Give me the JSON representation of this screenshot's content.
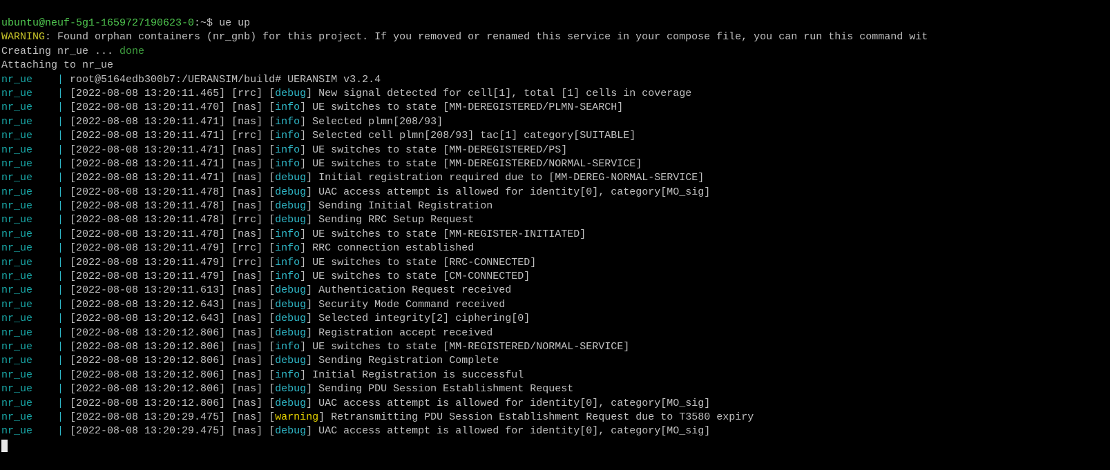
{
  "prompt": {
    "user_host": "ubuntu@neuf-5g1-1659727190623-0",
    "path_symbol": ":~$ ",
    "command": "ue up"
  },
  "warning_line": {
    "label": "WARNING",
    "text": ": Found orphan containers (nr_gnb) for this project. If you removed or renamed this service in your compose file, you can run this command wit"
  },
  "creating_line": {
    "text": "Creating nr_ue ... ",
    "status": "done"
  },
  "attaching_line": "Attaching to nr_ue",
  "log_prefix": "nr_ue",
  "log_separator": "    | ",
  "root_line": "root@5164edb300b7:/UERANSIM/build# UERANSIM v3.2.4",
  "log_entries": [
    {
      "ts": "[2022-08-08 13:20:11.465]",
      "module": "[rrc]",
      "level": "debug",
      "msg": " New signal detected for cell[1], total [1] cells in coverage"
    },
    {
      "ts": "[2022-08-08 13:20:11.470]",
      "module": "[nas]",
      "level": "info",
      "msg": " UE switches to state [MM-DEREGISTERED/PLMN-SEARCH]"
    },
    {
      "ts": "[2022-08-08 13:20:11.471]",
      "module": "[nas]",
      "level": "info",
      "msg": " Selected plmn[208/93]"
    },
    {
      "ts": "[2022-08-08 13:20:11.471]",
      "module": "[rrc]",
      "level": "info",
      "msg": " Selected cell plmn[208/93] tac[1] category[SUITABLE]"
    },
    {
      "ts": "[2022-08-08 13:20:11.471]",
      "module": "[nas]",
      "level": "info",
      "msg": " UE switches to state [MM-DEREGISTERED/PS]"
    },
    {
      "ts": "[2022-08-08 13:20:11.471]",
      "module": "[nas]",
      "level": "info",
      "msg": " UE switches to state [MM-DEREGISTERED/NORMAL-SERVICE]"
    },
    {
      "ts": "[2022-08-08 13:20:11.471]",
      "module": "[nas]",
      "level": "debug",
      "msg": " Initial registration required due to [MM-DEREG-NORMAL-SERVICE]"
    },
    {
      "ts": "[2022-08-08 13:20:11.478]",
      "module": "[nas]",
      "level": "debug",
      "msg": " UAC access attempt is allowed for identity[0], category[MO_sig]"
    },
    {
      "ts": "[2022-08-08 13:20:11.478]",
      "module": "[nas]",
      "level": "debug",
      "msg": " Sending Initial Registration"
    },
    {
      "ts": "[2022-08-08 13:20:11.478]",
      "module": "[rrc]",
      "level": "debug",
      "msg": " Sending RRC Setup Request"
    },
    {
      "ts": "[2022-08-08 13:20:11.478]",
      "module": "[nas]",
      "level": "info",
      "msg": " UE switches to state [MM-REGISTER-INITIATED]"
    },
    {
      "ts": "[2022-08-08 13:20:11.479]",
      "module": "[rrc]",
      "level": "info",
      "msg": " RRC connection established"
    },
    {
      "ts": "[2022-08-08 13:20:11.479]",
      "module": "[rrc]",
      "level": "info",
      "msg": " UE switches to state [RRC-CONNECTED]"
    },
    {
      "ts": "[2022-08-08 13:20:11.479]",
      "module": "[nas]",
      "level": "info",
      "msg": " UE switches to state [CM-CONNECTED]"
    },
    {
      "ts": "[2022-08-08 13:20:11.613]",
      "module": "[nas]",
      "level": "debug",
      "msg": " Authentication Request received"
    },
    {
      "ts": "[2022-08-08 13:20:12.643]",
      "module": "[nas]",
      "level": "debug",
      "msg": " Security Mode Command received"
    },
    {
      "ts": "[2022-08-08 13:20:12.643]",
      "module": "[nas]",
      "level": "debug",
      "msg": " Selected integrity[2] ciphering[0]"
    },
    {
      "ts": "[2022-08-08 13:20:12.806]",
      "module": "[nas]",
      "level": "debug",
      "msg": " Registration accept received"
    },
    {
      "ts": "[2022-08-08 13:20:12.806]",
      "module": "[nas]",
      "level": "info",
      "msg": " UE switches to state [MM-REGISTERED/NORMAL-SERVICE]"
    },
    {
      "ts": "[2022-08-08 13:20:12.806]",
      "module": "[nas]",
      "level": "debug",
      "msg": " Sending Registration Complete"
    },
    {
      "ts": "[2022-08-08 13:20:12.806]",
      "module": "[nas]",
      "level": "info",
      "msg": " Initial Registration is successful"
    },
    {
      "ts": "[2022-08-08 13:20:12.806]",
      "module": "[nas]",
      "level": "debug",
      "msg": " Sending PDU Session Establishment Request"
    },
    {
      "ts": "[2022-08-08 13:20:12.806]",
      "module": "[nas]",
      "level": "debug",
      "msg": " UAC access attempt is allowed for identity[0], category[MO_sig]"
    },
    {
      "ts": "[2022-08-08 13:20:29.475]",
      "module": "[nas]",
      "level": "warning",
      "msg": " Retransmitting PDU Session Establishment Request due to T3580 expiry"
    },
    {
      "ts": "[2022-08-08 13:20:29.475]",
      "module": "[nas]",
      "level": "debug",
      "msg": " UAC access attempt is allowed for identity[0], category[MO_sig]"
    }
  ],
  "colors": {
    "background": "#000000",
    "text": "#c0c0c0",
    "prompt": "#4fc74f",
    "warning": "#c7c42a",
    "done": "#3f9f3f",
    "prefix": "#18a6a6",
    "level": "#2fb8c8",
    "warning_level": "#e6d300",
    "cursor": "#e8e8e8"
  }
}
